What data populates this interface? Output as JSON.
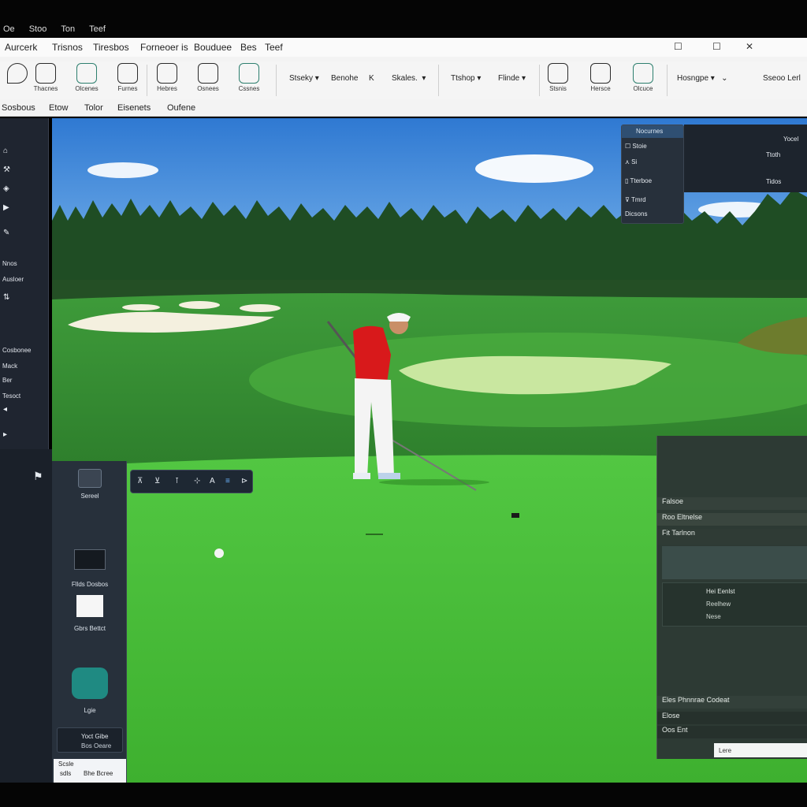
{
  "system_menu": [
    "Oe",
    "Stoo",
    "Ton",
    "Teef"
  ],
  "ribbon": {
    "tabs": [
      "Aurcerk",
      "Trisnos",
      "Tiresbos",
      "Forneoer is",
      "Bouduee",
      "Bes",
      "Teef"
    ],
    "window_controls": [
      "☐",
      "☐",
      "✕"
    ],
    "tools": [
      {
        "label": "",
        "icon": "pin-icon"
      },
      {
        "label": "Thacnes",
        "icon": "person-icon"
      },
      {
        "label": "Olcenes",
        "icon": "crowd-icon"
      },
      {
        "label": "Furnes",
        "icon": "swing-icon"
      },
      {
        "label": "Hebres",
        "icon": "golfer-icon"
      },
      {
        "label": "Osnees",
        "icon": "club-icon"
      },
      {
        "label": "Cssnes",
        "icon": "bag-icon"
      }
    ],
    "dropdowns": [
      "Stseky",
      "Benohe",
      "K",
      "Skales.",
      "Ttshop",
      "Flinde"
    ],
    "right_tools": [
      {
        "label": "Stsnis",
        "icon": "screen-icon"
      },
      {
        "label": "Hersce",
        "icon": "monitor-icon"
      },
      {
        "label": "Olcuce",
        "icon": "chart-icon"
      }
    ],
    "right_dropdown": "Hosngpe",
    "right_text": "Sseoo Lerl",
    "subtabs": [
      "Sosbous",
      "Etow",
      "Tolor",
      "Eisenets",
      "Oufene"
    ]
  },
  "left_strip": {
    "items": [
      "Nnos",
      "Ausloer",
      "Cosbonee",
      "Mack",
      "Ber",
      "Tesoct"
    ],
    "glyphs": [
      "⌂",
      "⚒",
      "◈",
      "▶",
      "✎",
      "⇅",
      "◂",
      "▸",
      "⚑"
    ]
  },
  "lower_panel": {
    "cards": [
      {
        "label": "Sereel",
        "icon": "camera-icon"
      },
      {
        "label": "Fllds Dosbos",
        "icon": "video-icon"
      },
      {
        "label": "Gbrs Bettct",
        "icon": "image-icon"
      },
      {
        "label": "Lgie",
        "icon": "golf-app-icon"
      }
    ],
    "footer_btn": {
      "title": "Yoct Gibe",
      "sub": "Bos Oeare"
    },
    "footer_text": [
      "Scsle",
      "Bhe Bcree",
      "sdls"
    ]
  },
  "float_toolbar": [
    "⊼",
    "⊻",
    "⊺",
    "⊹",
    "A",
    "≡",
    "⊳"
  ],
  "popup": {
    "header": "Nocurnes",
    "rows": [
      "Stoie",
      "Si",
      "Tterboe",
      "Tmrd",
      "Dicsons"
    ]
  },
  "popup_right": [
    "Yocel",
    "Ttoth",
    "Tidos"
  ],
  "right_panel": {
    "rows": [
      "Falsoe",
      "Roo Eltnelse",
      "Fit Tarlnon",
      "Hei Eenlst",
      "Reelhew",
      "Nese",
      "Eles Phnnrae Codeat",
      "Elose",
      "Oos Ent",
      "Lere"
    ]
  },
  "colors": {
    "ribbon": "#f3f3f3",
    "panel": "#27303b",
    "accent": "#2d7f6e",
    "sky": "#3f8fde",
    "green": "#45c33a"
  }
}
